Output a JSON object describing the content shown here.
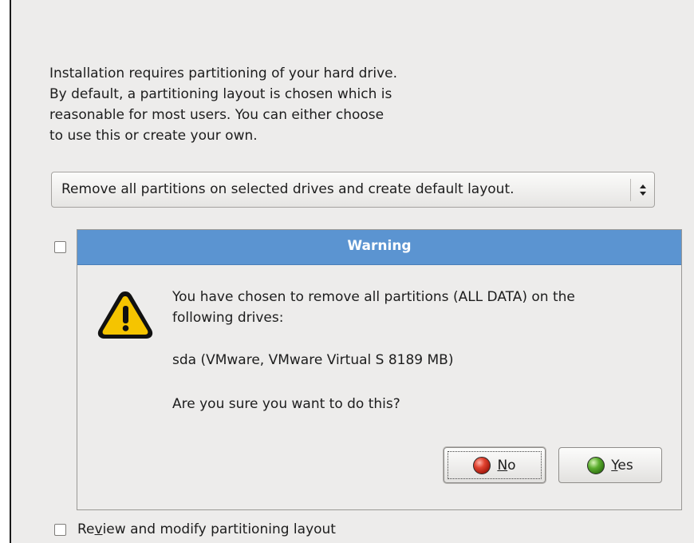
{
  "intro": {
    "lines": [
      "Installation requires partitioning of your hard drive.",
      "By default, a partitioning layout is chosen which is",
      "reasonable for most users.  You can either choose",
      "to use this or create your own."
    ]
  },
  "layout_combo": {
    "selected": "Remove all partitions on selected drives and create default layout."
  },
  "review_checkbox": {
    "checked": false,
    "label": "Review and modify partitioning layout"
  },
  "encrypt_checkbox": {
    "checked": false
  },
  "dialog": {
    "title": "Warning",
    "icon": "warning-icon",
    "message_line1": "You have chosen to remove all partitions (ALL DATA) on the",
    "message_line2": "following drives:",
    "drive": "sda (VMware, VMware Virtual S 8189 MB)",
    "question": "Are you sure you want to do this?",
    "buttons": {
      "no": {
        "label": "No",
        "mnemonic": "N",
        "rest": "o",
        "icon": "red-ball-icon"
      },
      "yes": {
        "label": "Yes",
        "mnemonic": "Y",
        "rest": "es",
        "icon": "green-ball-icon"
      }
    },
    "colors": {
      "titlebar": "#5b94d1",
      "title_text": "#ffffff"
    }
  }
}
